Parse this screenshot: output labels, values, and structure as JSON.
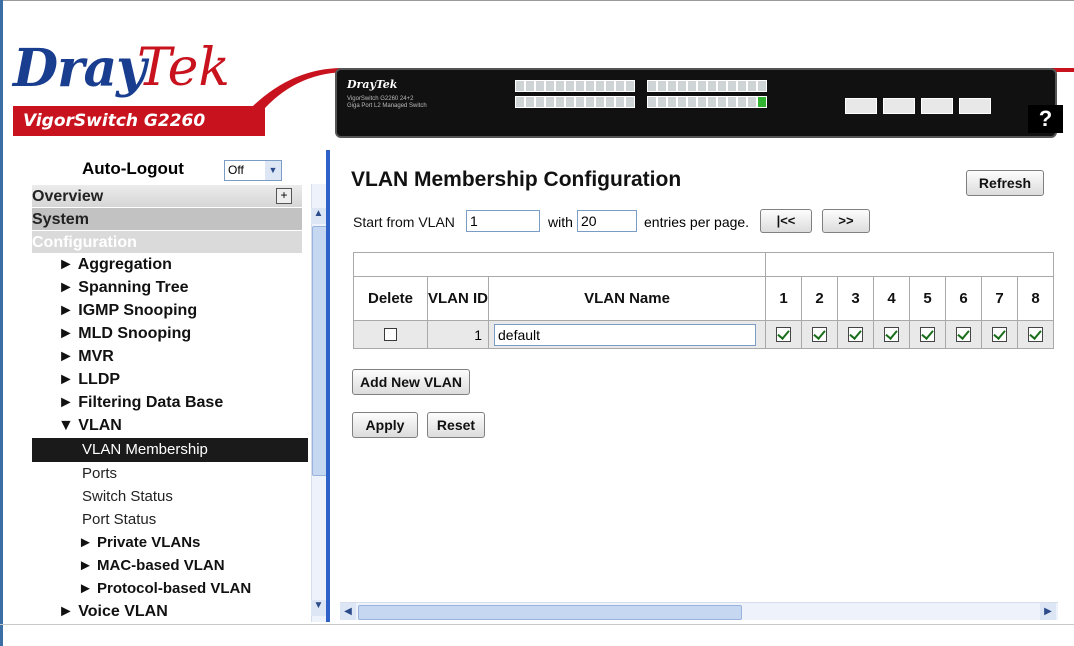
{
  "brand": {
    "logo_dray": "Dray",
    "logo_tek": "Tek",
    "model": "VigorSwitch G2260"
  },
  "device": {
    "logo": "DrayTek",
    "subtitle": "VigorSwitch G2260 24+2 Giga Port L2 Managed Switch"
  },
  "help": {
    "label": "?"
  },
  "nav": {
    "autologout_label": "Auto-Logout",
    "autologout_value": "Off",
    "overview": "Overview",
    "system": "System",
    "configuration": "Configuration",
    "items": [
      "► Aggregation",
      "► Spanning Tree",
      "► IGMP Snooping",
      "► MLD Snooping",
      "► MVR",
      "► LLDP",
      "► Filtering Data Base",
      "▼ VLAN"
    ],
    "vlan_membership": "VLAN Membership",
    "sub_items": [
      "Ports",
      "Switch Status",
      "Port Status"
    ],
    "vlan_children": [
      "► Private VLANs",
      "► MAC-based VLAN",
      "► Protocol-based VLAN"
    ],
    "voice_vlan": "► Voice VLAN"
  },
  "main": {
    "title": "VLAN Membership Configuration",
    "refresh_label": "Refresh",
    "start_label": "Start from VLAN",
    "start_value": "1",
    "with_label": "with",
    "entries_value": "20",
    "entries_label": "entries per page.",
    "first_label": "|<<",
    "next_label": ">>",
    "table": {
      "headers": {
        "delete": "Delete",
        "vlan_id": "VLAN ID",
        "vlan_name": "VLAN Name"
      },
      "ports": [
        "1",
        "2",
        "3",
        "4",
        "5",
        "6",
        "7",
        "8"
      ],
      "rows": [
        {
          "delete_checked": false,
          "vlan_id": "1",
          "vlan_name": "default",
          "members": [
            true,
            true,
            true,
            true,
            true,
            true,
            true,
            true
          ]
        }
      ]
    },
    "add_new_label": "Add New VLAN",
    "apply_label": "Apply",
    "reset_label": "Reset"
  },
  "colors": {
    "brand_red": "#c8121e",
    "brand_blue": "#1a3e8f",
    "divider_blue": "#2e62c9",
    "selected_nav": "#1a1a1a"
  }
}
